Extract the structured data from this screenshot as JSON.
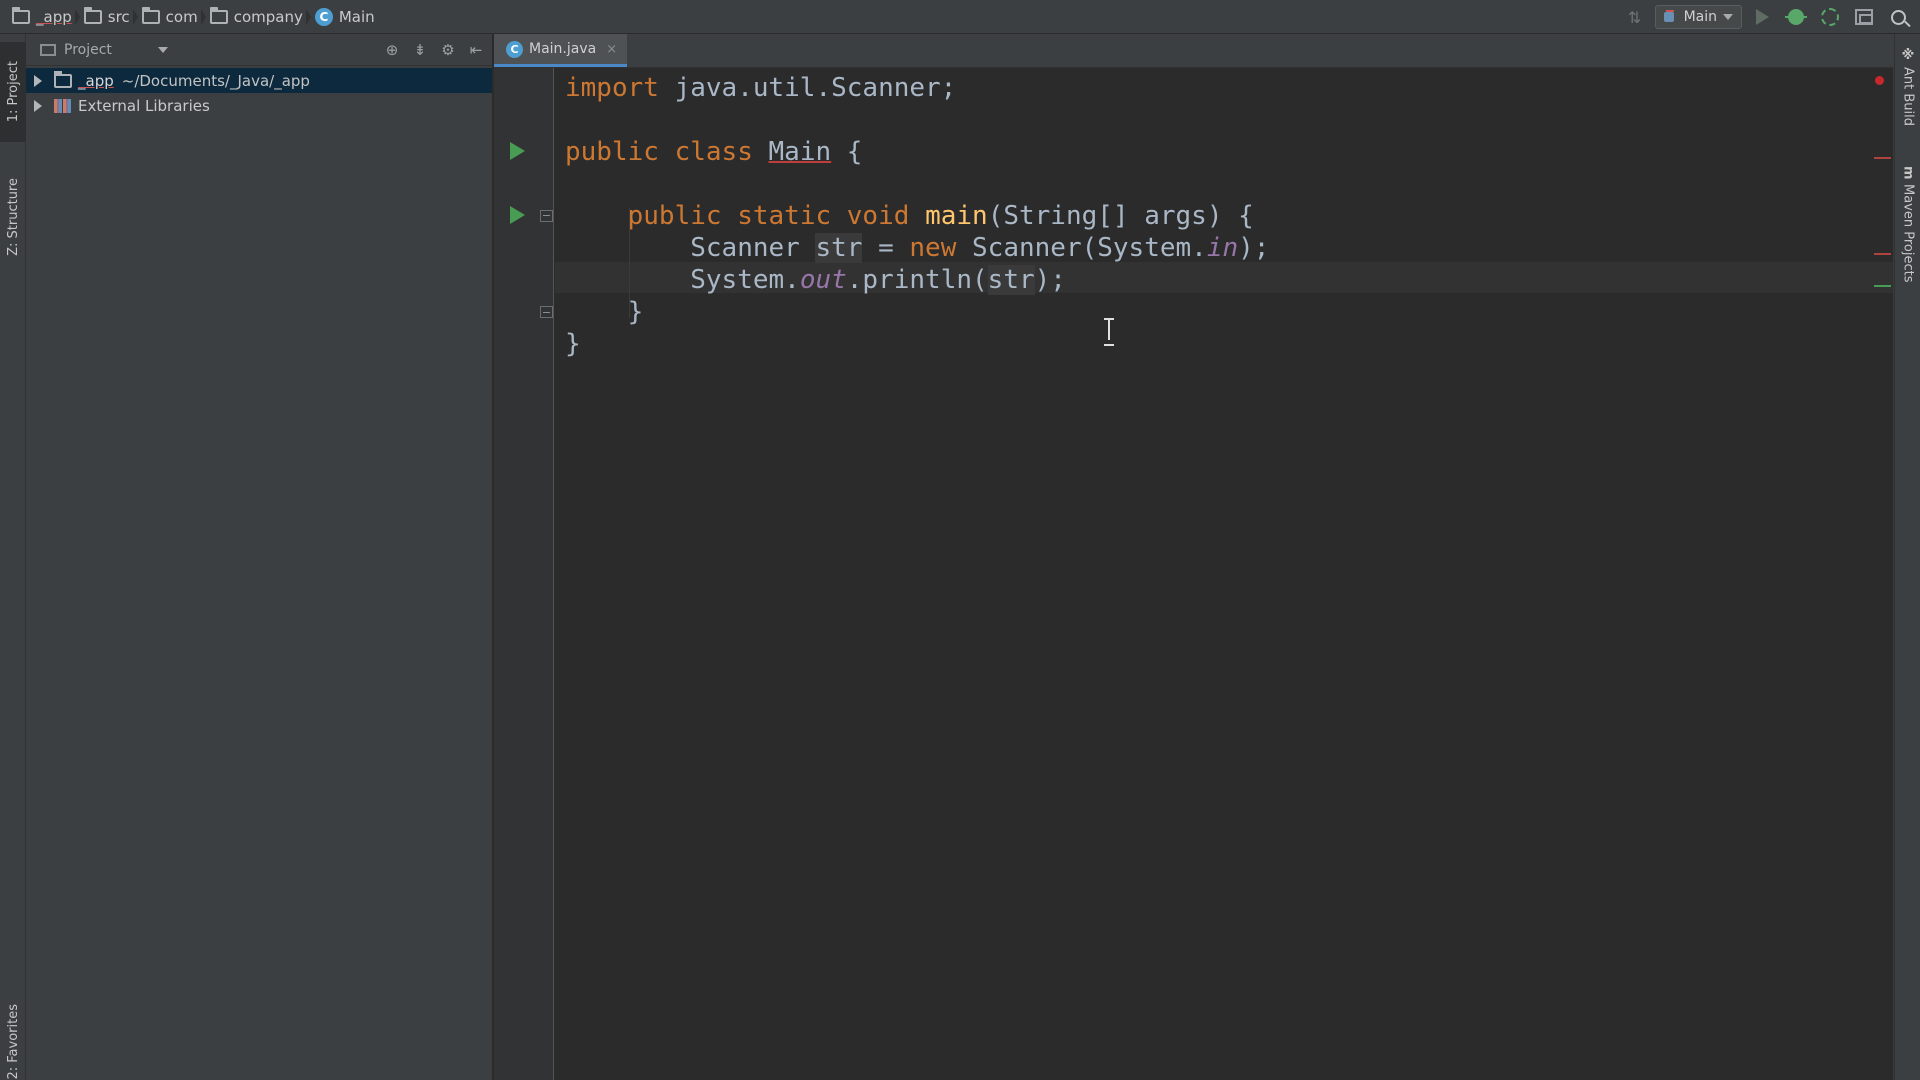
{
  "navbar": {
    "breadcrumbs": [
      {
        "label": "_app",
        "icon": "folder-icon"
      },
      {
        "label": "src",
        "icon": "folder-icon"
      },
      {
        "label": "com",
        "icon": "folder-icon"
      },
      {
        "label": "company",
        "icon": "folder-icon"
      },
      {
        "label": "Main",
        "icon": "class-icon",
        "icon_glyph": "C"
      }
    ],
    "run_config": "Main"
  },
  "left_stripe": {
    "tabs": [
      "1: Project",
      "Z: Structure",
      "2: Favorites"
    ]
  },
  "project_panel": {
    "title": "Project",
    "tree": [
      {
        "name": "_app",
        "path": "~/Documents/_Java/_app",
        "selected": true
      },
      {
        "name": "External Libraries",
        "path": "",
        "selected": false
      }
    ]
  },
  "editor": {
    "tab_label": "Main.java",
    "tab_close": "×",
    "code": {
      "l1_kw": "import",
      "l1_rest": " java.util.Scanner;",
      "l3_kw1": "public",
      "l3_kw2": "class",
      "l3_name": "Main",
      "l3_brace": " {",
      "l5_kw1": "public",
      "l5_kw2": "static",
      "l5_kw3": "void",
      "l5_fn": "main",
      "l5_rest": "(String[] args) {",
      "l6_type": "Scanner ",
      "l6_var": "str",
      "l6_eq": " = ",
      "l6_kw": "new",
      "l6_call": " Scanner(System.",
      "l6_static": "in",
      "l6_end": ");",
      "l7_sys": "System.",
      "l7_static": "out",
      "l7_call": ".println(",
      "l7_arg": "str",
      "l7_end": ");",
      "l8": "}",
      "l9": "}"
    }
  },
  "right_stripe": {
    "tabs": [
      "Ant Build",
      "Maven Projects"
    ]
  },
  "colors": {
    "keyword": "#cc7832",
    "function": "#ffc66d",
    "static_field": "#9876aa",
    "plain": "#a9b7c6",
    "background": "#2b2b2b",
    "run_marker": "#499c54",
    "error": "#c8282c"
  }
}
